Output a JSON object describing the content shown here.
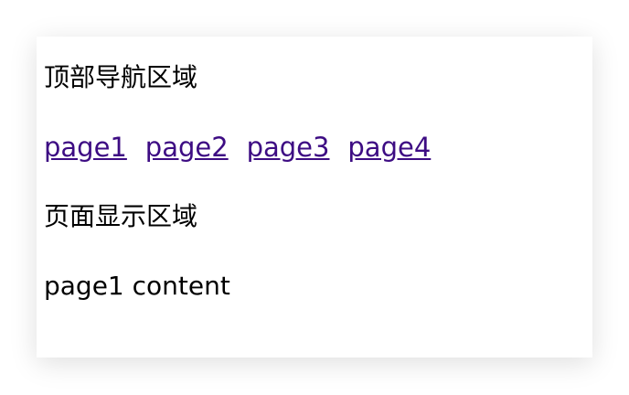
{
  "nav": {
    "title": "顶部导航区域",
    "links": [
      "page1",
      "page2",
      "page3",
      "page4"
    ]
  },
  "view": {
    "title": "页面显示区域",
    "content": "page1 content"
  },
  "colors": {
    "link": "#3d0c83",
    "text": "#000000",
    "background": "#ffffff"
  }
}
